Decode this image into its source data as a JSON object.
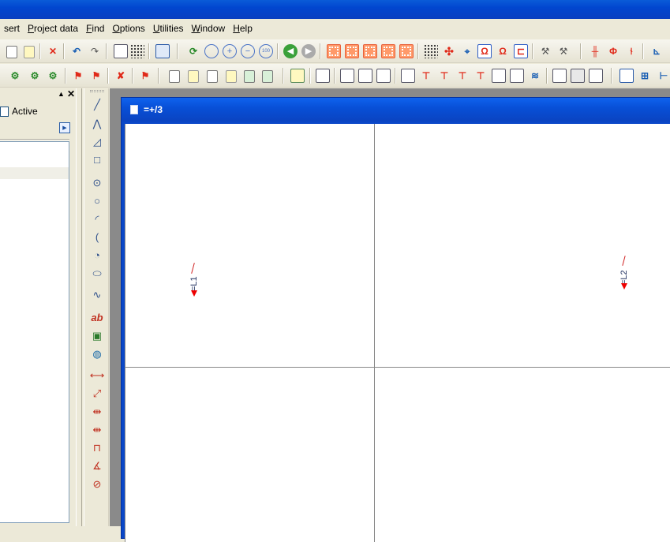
{
  "menu": {
    "items": [
      {
        "label": "sert",
        "key": ""
      },
      {
        "label": "Project data",
        "key": "P"
      },
      {
        "label": "Find",
        "key": "F"
      },
      {
        "label": "Options",
        "key": "O"
      },
      {
        "label": "Utilities",
        "key": "U"
      },
      {
        "label": "Window",
        "key": "W"
      },
      {
        "label": "Help",
        "key": "H"
      }
    ]
  },
  "panel": {
    "active_label": "Active",
    "pin_glyph": "▲",
    "close_glyph": "✕",
    "play_glyph": "▶"
  },
  "document": {
    "title": "=+/3"
  },
  "schematic": {
    "labels": [
      "=L1",
      "=L2"
    ]
  },
  "colors": {
    "title_blue": "#0a47c8",
    "symbol_red": "#e00000",
    "grid_gray": "#888888"
  }
}
